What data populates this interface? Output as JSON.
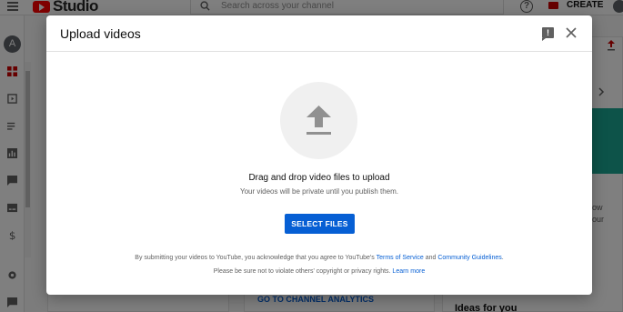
{
  "app": {
    "logo_text": "Studio",
    "search_placeholder": "Search across your channel",
    "create_label": "CREATE",
    "avatar_initial": "A"
  },
  "background": {
    "analytics_link": "GO TO CHANNEL ANALYTICS",
    "ideas_heading": "Ideas for you",
    "right_snippet_1": "ow",
    "right_snippet_2": "our"
  },
  "dialog": {
    "title": "Upload videos",
    "drag_title": "Drag and drop video files to upload",
    "drag_subtitle": "Your videos will be private until you publish them.",
    "select_button": "SELECT FILES",
    "legal_line1_prefix": "By submitting your videos to YouTube, you acknowledge that you agree to YouTube's ",
    "terms_link": "Terms of Service",
    "legal_and": " and ",
    "guidelines_link": "Community Guidelines",
    "legal_period": ".",
    "legal_line2_prefix": "Please be sure not to violate others' copyright or privacy rights. ",
    "learn_more_link": "Learn more"
  },
  "colors": {
    "accent": "#065fd4",
    "brand_red": "#ff0000"
  }
}
